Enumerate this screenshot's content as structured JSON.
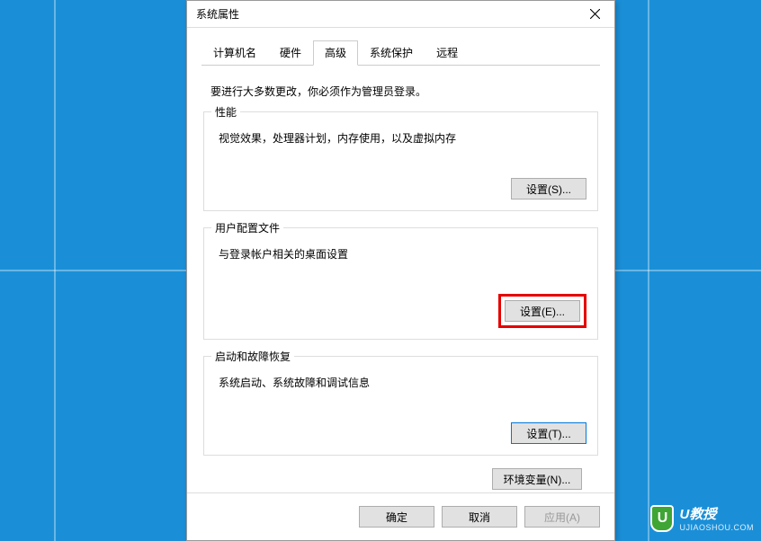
{
  "dialog": {
    "title": "系统属性",
    "tabs": {
      "computer_name": "计算机名",
      "hardware": "硬件",
      "advanced": "高级",
      "system_protection": "系统保护",
      "remote": "远程"
    },
    "notice": "要进行大多数更改，你必须作为管理员登录。",
    "groups": {
      "performance": {
        "legend": "性能",
        "desc": "视觉效果，处理器计划，内存使用，以及虚拟内存",
        "button": "设置(S)..."
      },
      "profiles": {
        "legend": "用户配置文件",
        "desc": "与登录帐户相关的桌面设置",
        "button": "设置(E)..."
      },
      "startup": {
        "legend": "启动和故障恢复",
        "desc": "系统启动、系统故障和调试信息",
        "button": "设置(T)..."
      }
    },
    "env_button": "环境变量(N)...",
    "footer": {
      "ok": "确定",
      "cancel": "取消",
      "apply": "应用(A)"
    }
  },
  "watermark": {
    "brand": "U教授",
    "url": "UJIAOSHOU.COM",
    "icon_letter": "U"
  }
}
